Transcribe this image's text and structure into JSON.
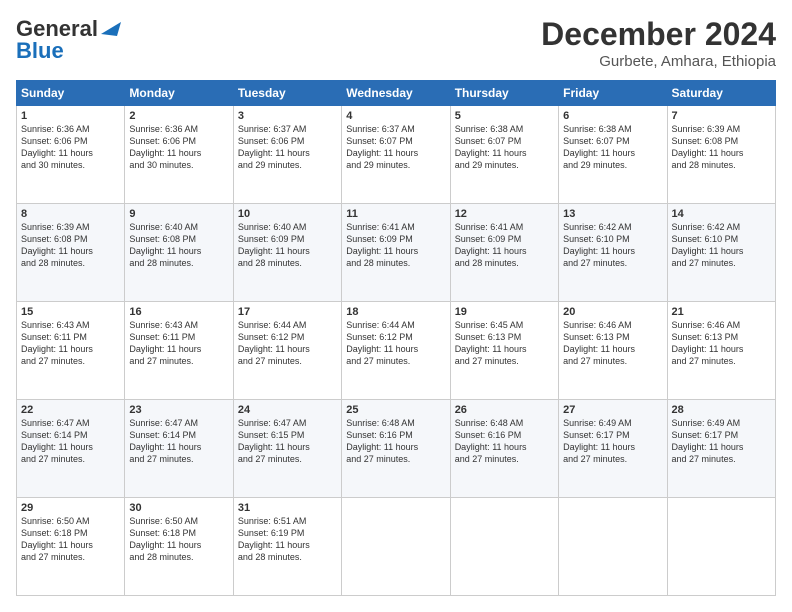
{
  "header": {
    "logo_general": "General",
    "logo_blue": "Blue",
    "title": "December 2024",
    "subtitle": "Gurbete, Amhara, Ethiopia"
  },
  "weekdays": [
    "Sunday",
    "Monday",
    "Tuesday",
    "Wednesday",
    "Thursday",
    "Friday",
    "Saturday"
  ],
  "weeks": [
    [
      {
        "day": "1",
        "lines": [
          "Sunrise: 6:36 AM",
          "Sunset: 6:06 PM",
          "Daylight: 11 hours",
          "and 30 minutes."
        ]
      },
      {
        "day": "2",
        "lines": [
          "Sunrise: 6:36 AM",
          "Sunset: 6:06 PM",
          "Daylight: 11 hours",
          "and 30 minutes."
        ]
      },
      {
        "day": "3",
        "lines": [
          "Sunrise: 6:37 AM",
          "Sunset: 6:06 PM",
          "Daylight: 11 hours",
          "and 29 minutes."
        ]
      },
      {
        "day": "4",
        "lines": [
          "Sunrise: 6:37 AM",
          "Sunset: 6:07 PM",
          "Daylight: 11 hours",
          "and 29 minutes."
        ]
      },
      {
        "day": "5",
        "lines": [
          "Sunrise: 6:38 AM",
          "Sunset: 6:07 PM",
          "Daylight: 11 hours",
          "and 29 minutes."
        ]
      },
      {
        "day": "6",
        "lines": [
          "Sunrise: 6:38 AM",
          "Sunset: 6:07 PM",
          "Daylight: 11 hours",
          "and 29 minutes."
        ]
      },
      {
        "day": "7",
        "lines": [
          "Sunrise: 6:39 AM",
          "Sunset: 6:08 PM",
          "Daylight: 11 hours",
          "and 28 minutes."
        ]
      }
    ],
    [
      {
        "day": "8",
        "lines": [
          "Sunrise: 6:39 AM",
          "Sunset: 6:08 PM",
          "Daylight: 11 hours",
          "and 28 minutes."
        ]
      },
      {
        "day": "9",
        "lines": [
          "Sunrise: 6:40 AM",
          "Sunset: 6:08 PM",
          "Daylight: 11 hours",
          "and 28 minutes."
        ]
      },
      {
        "day": "10",
        "lines": [
          "Sunrise: 6:40 AM",
          "Sunset: 6:09 PM",
          "Daylight: 11 hours",
          "and 28 minutes."
        ]
      },
      {
        "day": "11",
        "lines": [
          "Sunrise: 6:41 AM",
          "Sunset: 6:09 PM",
          "Daylight: 11 hours",
          "and 28 minutes."
        ]
      },
      {
        "day": "12",
        "lines": [
          "Sunrise: 6:41 AM",
          "Sunset: 6:09 PM",
          "Daylight: 11 hours",
          "and 28 minutes."
        ]
      },
      {
        "day": "13",
        "lines": [
          "Sunrise: 6:42 AM",
          "Sunset: 6:10 PM",
          "Daylight: 11 hours",
          "and 27 minutes."
        ]
      },
      {
        "day": "14",
        "lines": [
          "Sunrise: 6:42 AM",
          "Sunset: 6:10 PM",
          "Daylight: 11 hours",
          "and 27 minutes."
        ]
      }
    ],
    [
      {
        "day": "15",
        "lines": [
          "Sunrise: 6:43 AM",
          "Sunset: 6:11 PM",
          "Daylight: 11 hours",
          "and 27 minutes."
        ]
      },
      {
        "day": "16",
        "lines": [
          "Sunrise: 6:43 AM",
          "Sunset: 6:11 PM",
          "Daylight: 11 hours",
          "and 27 minutes."
        ]
      },
      {
        "day": "17",
        "lines": [
          "Sunrise: 6:44 AM",
          "Sunset: 6:12 PM",
          "Daylight: 11 hours",
          "and 27 minutes."
        ]
      },
      {
        "day": "18",
        "lines": [
          "Sunrise: 6:44 AM",
          "Sunset: 6:12 PM",
          "Daylight: 11 hours",
          "and 27 minutes."
        ]
      },
      {
        "day": "19",
        "lines": [
          "Sunrise: 6:45 AM",
          "Sunset: 6:13 PM",
          "Daylight: 11 hours",
          "and 27 minutes."
        ]
      },
      {
        "day": "20",
        "lines": [
          "Sunrise: 6:46 AM",
          "Sunset: 6:13 PM",
          "Daylight: 11 hours",
          "and 27 minutes."
        ]
      },
      {
        "day": "21",
        "lines": [
          "Sunrise: 6:46 AM",
          "Sunset: 6:13 PM",
          "Daylight: 11 hours",
          "and 27 minutes."
        ]
      }
    ],
    [
      {
        "day": "22",
        "lines": [
          "Sunrise: 6:47 AM",
          "Sunset: 6:14 PM",
          "Daylight: 11 hours",
          "and 27 minutes."
        ]
      },
      {
        "day": "23",
        "lines": [
          "Sunrise: 6:47 AM",
          "Sunset: 6:14 PM",
          "Daylight: 11 hours",
          "and 27 minutes."
        ]
      },
      {
        "day": "24",
        "lines": [
          "Sunrise: 6:47 AM",
          "Sunset: 6:15 PM",
          "Daylight: 11 hours",
          "and 27 minutes."
        ]
      },
      {
        "day": "25",
        "lines": [
          "Sunrise: 6:48 AM",
          "Sunset: 6:16 PM",
          "Daylight: 11 hours",
          "and 27 minutes."
        ]
      },
      {
        "day": "26",
        "lines": [
          "Sunrise: 6:48 AM",
          "Sunset: 6:16 PM",
          "Daylight: 11 hours",
          "and 27 minutes."
        ]
      },
      {
        "day": "27",
        "lines": [
          "Sunrise: 6:49 AM",
          "Sunset: 6:17 PM",
          "Daylight: 11 hours",
          "and 27 minutes."
        ]
      },
      {
        "day": "28",
        "lines": [
          "Sunrise: 6:49 AM",
          "Sunset: 6:17 PM",
          "Daylight: 11 hours",
          "and 27 minutes."
        ]
      }
    ],
    [
      {
        "day": "29",
        "lines": [
          "Sunrise: 6:50 AM",
          "Sunset: 6:18 PM",
          "Daylight: 11 hours",
          "and 27 minutes."
        ]
      },
      {
        "day": "30",
        "lines": [
          "Sunrise: 6:50 AM",
          "Sunset: 6:18 PM",
          "Daylight: 11 hours",
          "and 28 minutes."
        ]
      },
      {
        "day": "31",
        "lines": [
          "Sunrise: 6:51 AM",
          "Sunset: 6:19 PM",
          "Daylight: 11 hours",
          "and 28 minutes."
        ]
      },
      {
        "day": "",
        "lines": []
      },
      {
        "day": "",
        "lines": []
      },
      {
        "day": "",
        "lines": []
      },
      {
        "day": "",
        "lines": []
      }
    ]
  ]
}
